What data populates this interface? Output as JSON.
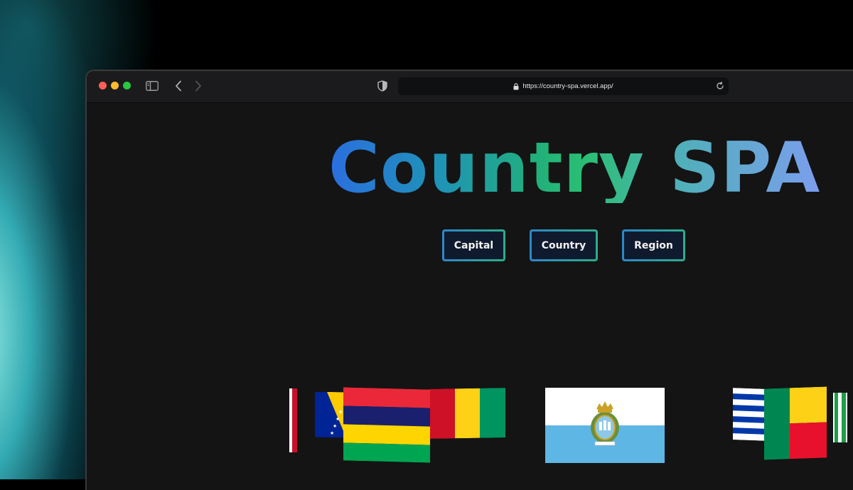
{
  "browser": {
    "url": "https://country-spa.vercel.app/",
    "icons": [
      "sidebar-icon",
      "back-icon",
      "forward-icon",
      "shield-icon",
      "lock-icon",
      "reload-icon"
    ]
  },
  "page": {
    "title": "Country SPA",
    "title_gradient": [
      "#2b6ee0",
      "#21b07a",
      "#7d9df0"
    ],
    "buttons": {
      "capital": "Capital",
      "country": "Country",
      "region": "Region"
    },
    "flags": [
      "partial-red-flag",
      "bosnia-herzegovina",
      "mauritius",
      "guinea",
      "san-marino",
      "uruguay",
      "benin",
      "partial-green-flag"
    ]
  },
  "colors": {
    "background": "#141414",
    "button_fill": "#101a2e",
    "button_border": [
      "#2c88c8",
      "#2cae8a"
    ]
  }
}
